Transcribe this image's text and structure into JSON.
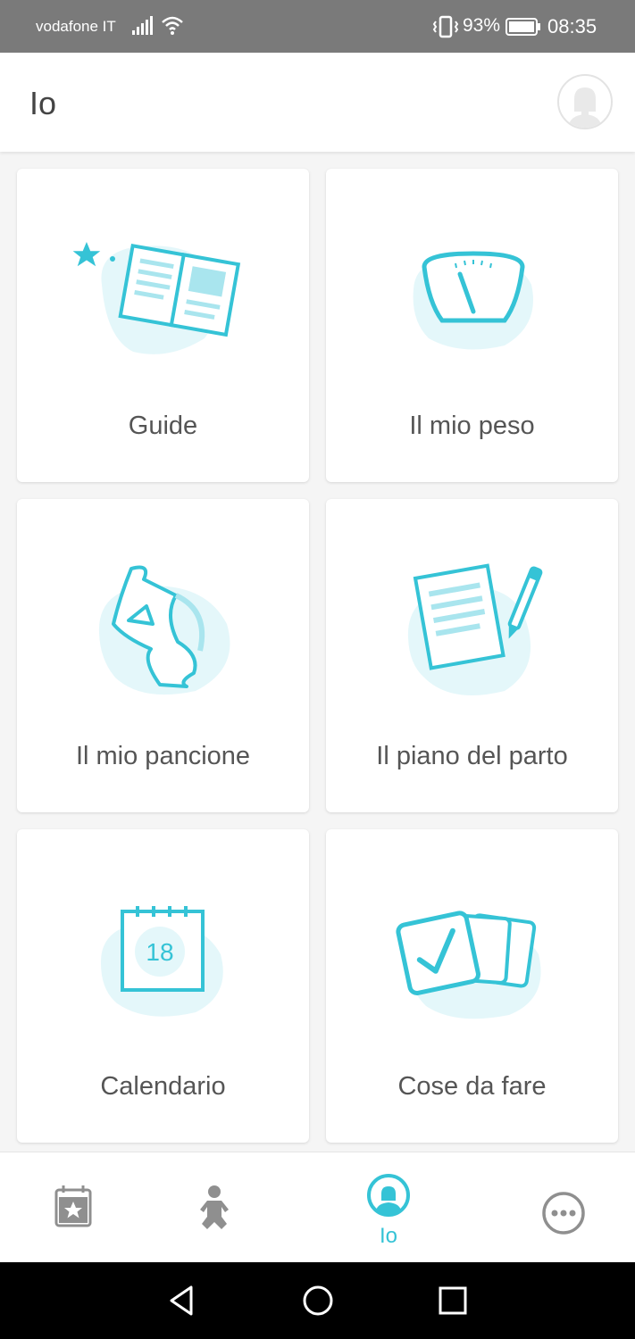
{
  "status_bar": {
    "carrier": "vodafone IT",
    "battery_percent": "93%",
    "time": "08:35",
    "icons": [
      "signal-icon",
      "wifi-icon",
      "vibrate-icon",
      "battery-icon"
    ]
  },
  "header": {
    "title": "Io",
    "avatar_icon": "profile-avatar-icon"
  },
  "cards": [
    {
      "label": "Guide",
      "icon": "book-icon"
    },
    {
      "label": "Il mio peso",
      "icon": "scale-icon"
    },
    {
      "label": "Il mio pancione",
      "icon": "pregnant-belly-icon"
    },
    {
      "label": "Il piano del parto",
      "icon": "document-pen-icon"
    },
    {
      "label": "Calendario",
      "icon": "calendar-icon",
      "calendar_day": "18"
    },
    {
      "label": "Cose da fare",
      "icon": "checklist-cards-icon"
    }
  ],
  "bottom_nav": {
    "items": [
      {
        "icon": "calendar-star-icon",
        "label": ""
      },
      {
        "icon": "baby-icon",
        "label": ""
      },
      {
        "icon": "profile-icon",
        "label": "Io",
        "active": true
      },
      {
        "icon": "more-icon",
        "label": ""
      }
    ]
  },
  "colors": {
    "accent": "#35c3d6",
    "accent_light": "#e4f7fa",
    "status_bar": "#7a7a7a",
    "text": "#555555"
  }
}
